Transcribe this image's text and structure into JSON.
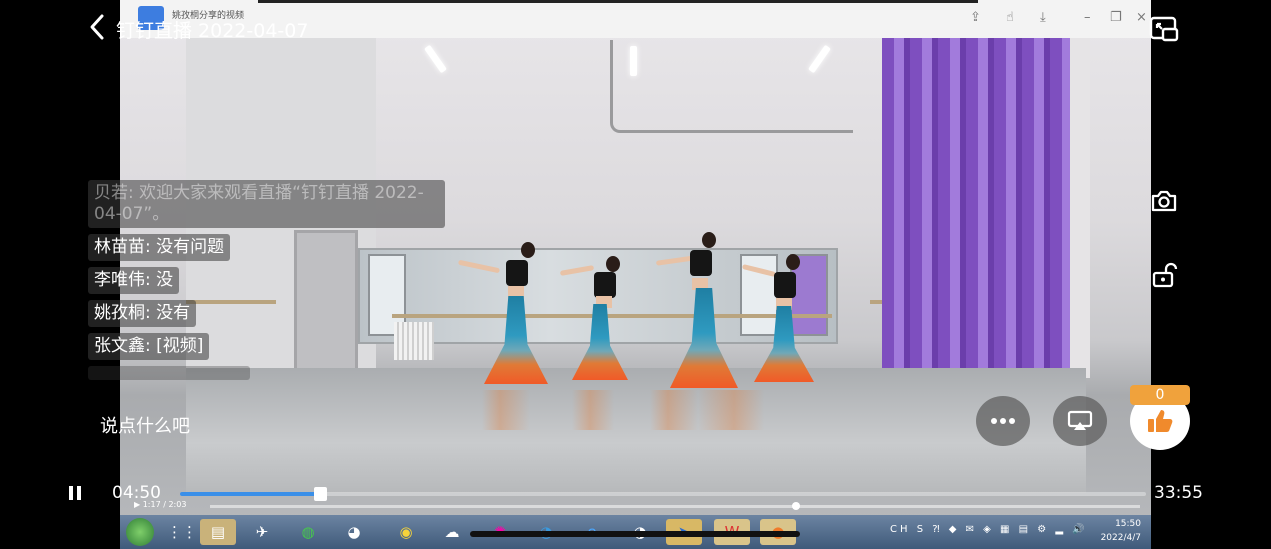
{
  "header": {
    "title": "钉钉直播 2022-04-07"
  },
  "embedded_window": {
    "title": "姚孜桐分享的视频"
  },
  "comments": [
    {
      "user": "贝若",
      "text": "欢迎大家来观看直播“钉钉直播 2022-04-07”。",
      "faded": true
    },
    {
      "user": "林苗苗",
      "text": "没有问题"
    },
    {
      "user": "李唯伟",
      "text": "没"
    },
    {
      "user": "姚孜桐",
      "text": "没有"
    },
    {
      "user": "张文鑫",
      "text": "[视频]"
    }
  ],
  "comment_input": {
    "placeholder": "说点什么吧"
  },
  "like": {
    "count": "0"
  },
  "player": {
    "current_time": "04:50",
    "total_time": "33:55",
    "progress": 0.145,
    "inner_time": "1:17 / 2:03",
    "inner_progress": 0.63
  },
  "taskbar": {
    "time": "15:50",
    "date": "2022/4/7",
    "lang": "CH"
  },
  "icons": {
    "back": "back-icon",
    "pip": "picture-in-picture-icon",
    "camera": "camera-icon",
    "lock": "unlock-icon",
    "more": "more-icon",
    "cast": "cast-icon",
    "like": "thumbs-up-icon"
  },
  "colors": {
    "accent": "#3a8fe8",
    "like_badge": "#f0a23c",
    "like_icon": "#f08a2c"
  }
}
